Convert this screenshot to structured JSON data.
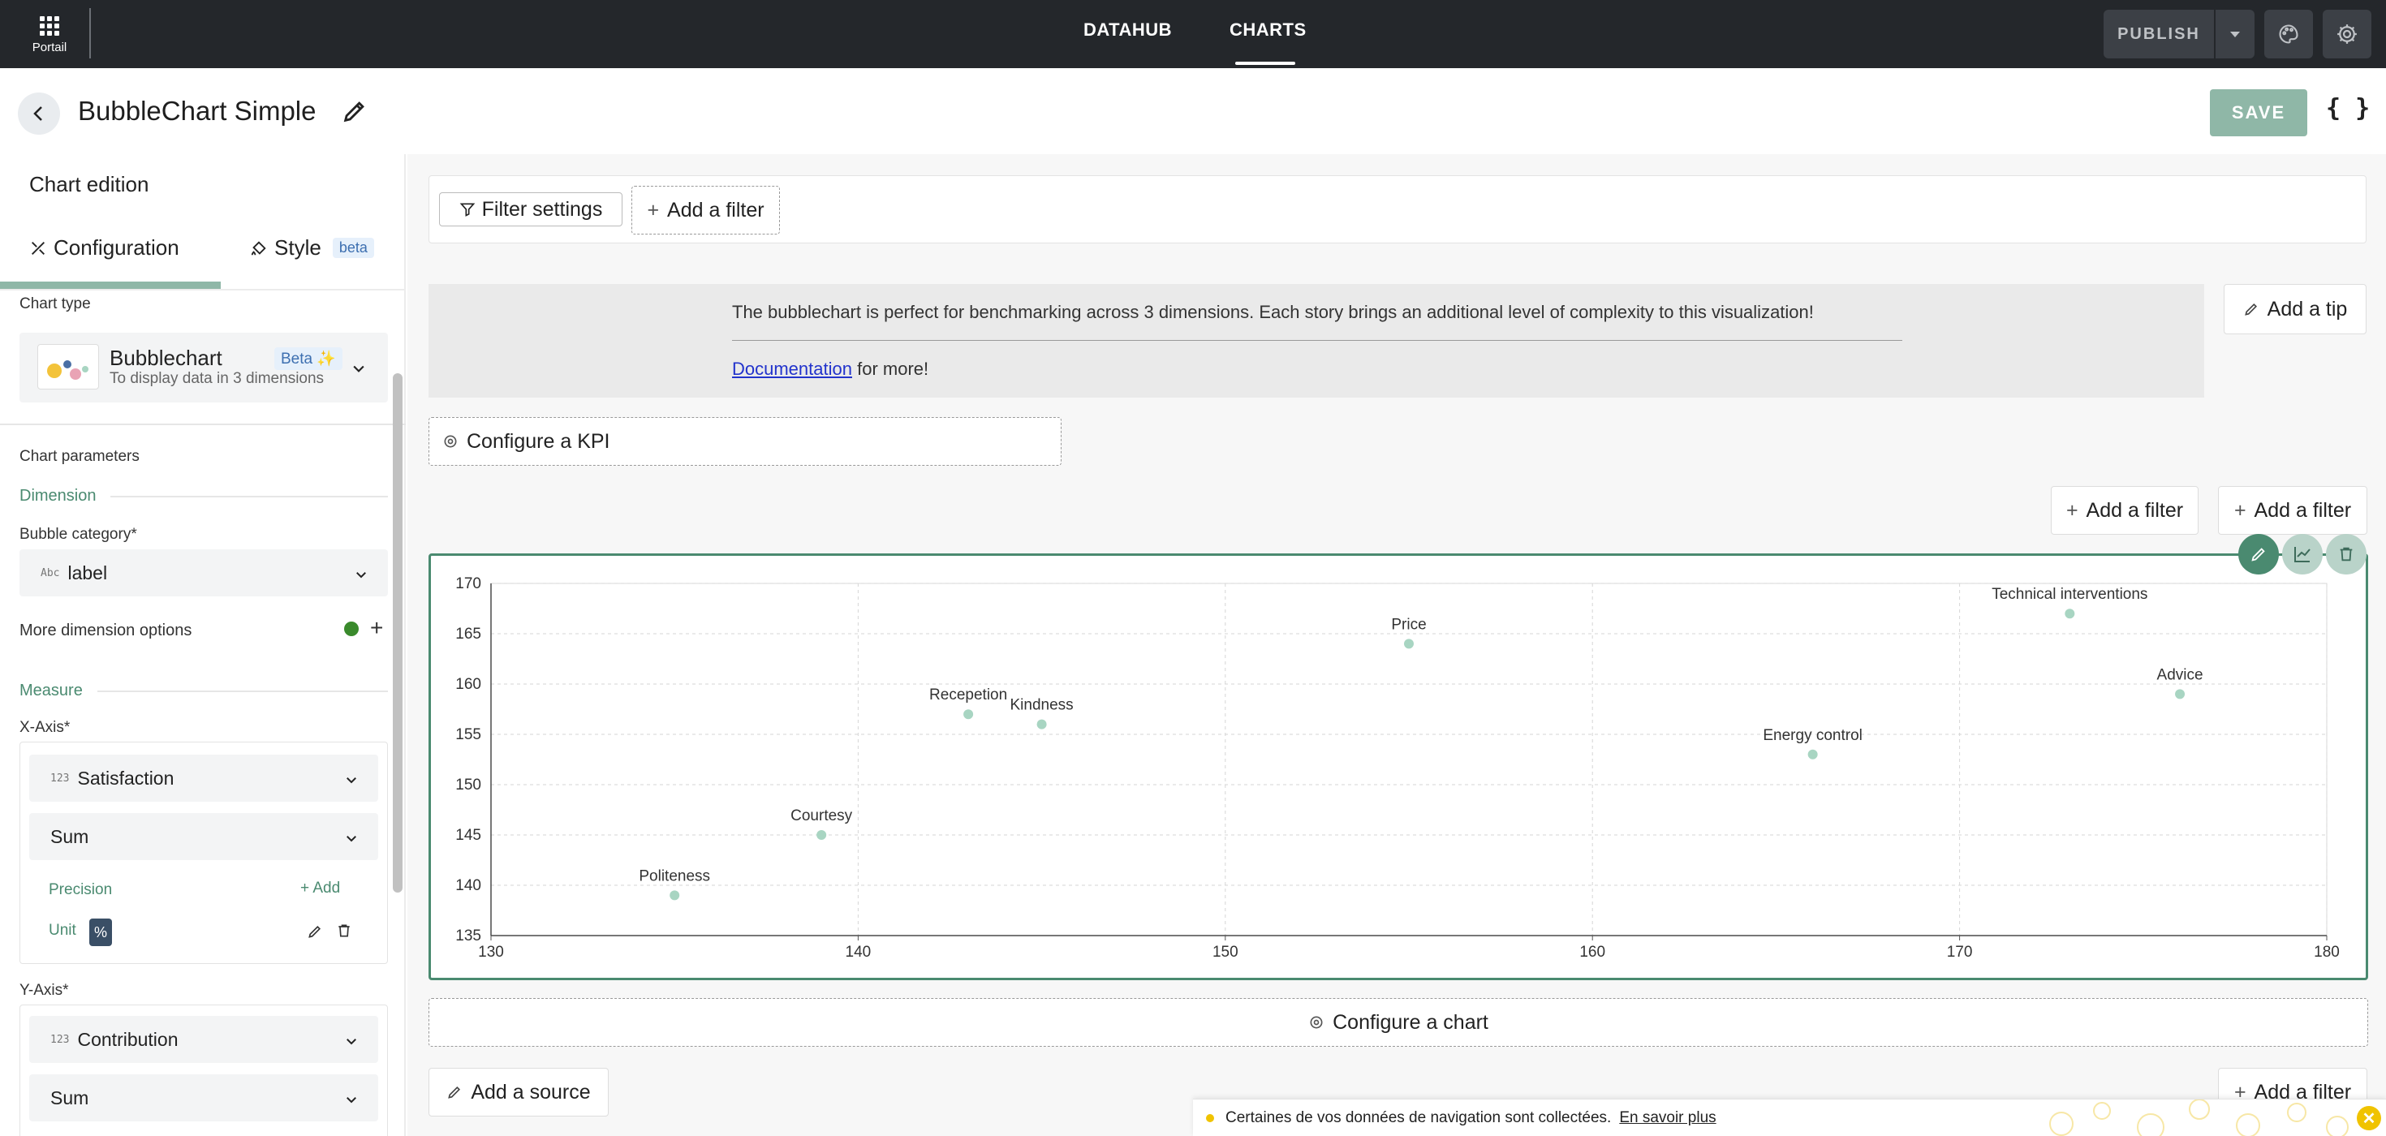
{
  "topbar": {
    "portal_label": "Portail",
    "nav": [
      "DATAHUB",
      "CHARTS"
    ],
    "active_nav": "CHARTS",
    "publish_label": "PUBLISH"
  },
  "header": {
    "title": "BubbleChart Simple",
    "save_label": "SAVE",
    "json_label": "{ }"
  },
  "left_panel": {
    "title": "Chart edition",
    "tabs": {
      "configuration": "Configuration",
      "style": "Style",
      "style_badge": "beta"
    },
    "chart_type": {
      "label": "Chart type",
      "name": "Bubblechart",
      "badge": "Beta ✨",
      "description": "To display data in 3 dimensions"
    },
    "chart_parameters_label": "Chart parameters",
    "dimension_label": "Dimension",
    "bubble_category": {
      "label": "Bubble category*",
      "value": "label",
      "type_icon": "Abc"
    },
    "more_dimension_label": "More dimension options",
    "measure_label": "Measure",
    "x_axis": {
      "label": "X-Axis*",
      "field": "Satisfaction",
      "field_type_icon": "123",
      "aggregation": "Sum",
      "precision_label": "Precision",
      "add_label": "+ Add",
      "unit_label": "Unit",
      "unit_value": "%"
    },
    "y_axis": {
      "label": "Y-Axis*",
      "field": "Contribution",
      "field_type_icon": "123",
      "aggregation": "Sum"
    }
  },
  "main": {
    "filter_settings_label": "Filter settings",
    "add_filter_label": "Add a filter",
    "tip_text": "The bubblechart is perfect for benchmarking across 3 dimensions. Each story brings an additional level of complexity to this visualization!",
    "tip_doc_link": "Documentation",
    "tip_doc_rest": "for more!",
    "add_tip_label": "Add a tip",
    "configure_kpi_label": "Configure a KPI",
    "configure_chart_label": "Configure a chart",
    "add_source_label": "Add a source"
  },
  "cookie": {
    "text": "Certaines de vos données de navigation sont collectées.",
    "link": "En savoir plus"
  },
  "colors": {
    "accent": "#4a8a70",
    "bubble": "#a8d5c2",
    "topbar": "#24272b"
  },
  "chart_data": {
    "type": "scatter",
    "xlim": [
      130,
      180
    ],
    "ylim": [
      135,
      170
    ],
    "xticks": [
      130,
      140,
      150,
      160,
      170,
      180
    ],
    "yticks": [
      135,
      140,
      145,
      150,
      155,
      160,
      165,
      170
    ],
    "grid": true,
    "points": [
      {
        "label": "Politeness",
        "x": 135,
        "y": 139
      },
      {
        "label": "Courtesy",
        "x": 139,
        "y": 145
      },
      {
        "label": "Recepetion",
        "x": 143,
        "y": 157
      },
      {
        "label": "Kindness",
        "x": 145,
        "y": 156
      },
      {
        "label": "Price",
        "x": 155,
        "y": 164
      },
      {
        "label": "Energy control",
        "x": 166,
        "y": 153
      },
      {
        "label": "Technical interventions",
        "x": 173,
        "y": 167
      },
      {
        "label": "Advice",
        "x": 176,
        "y": 159
      }
    ]
  }
}
